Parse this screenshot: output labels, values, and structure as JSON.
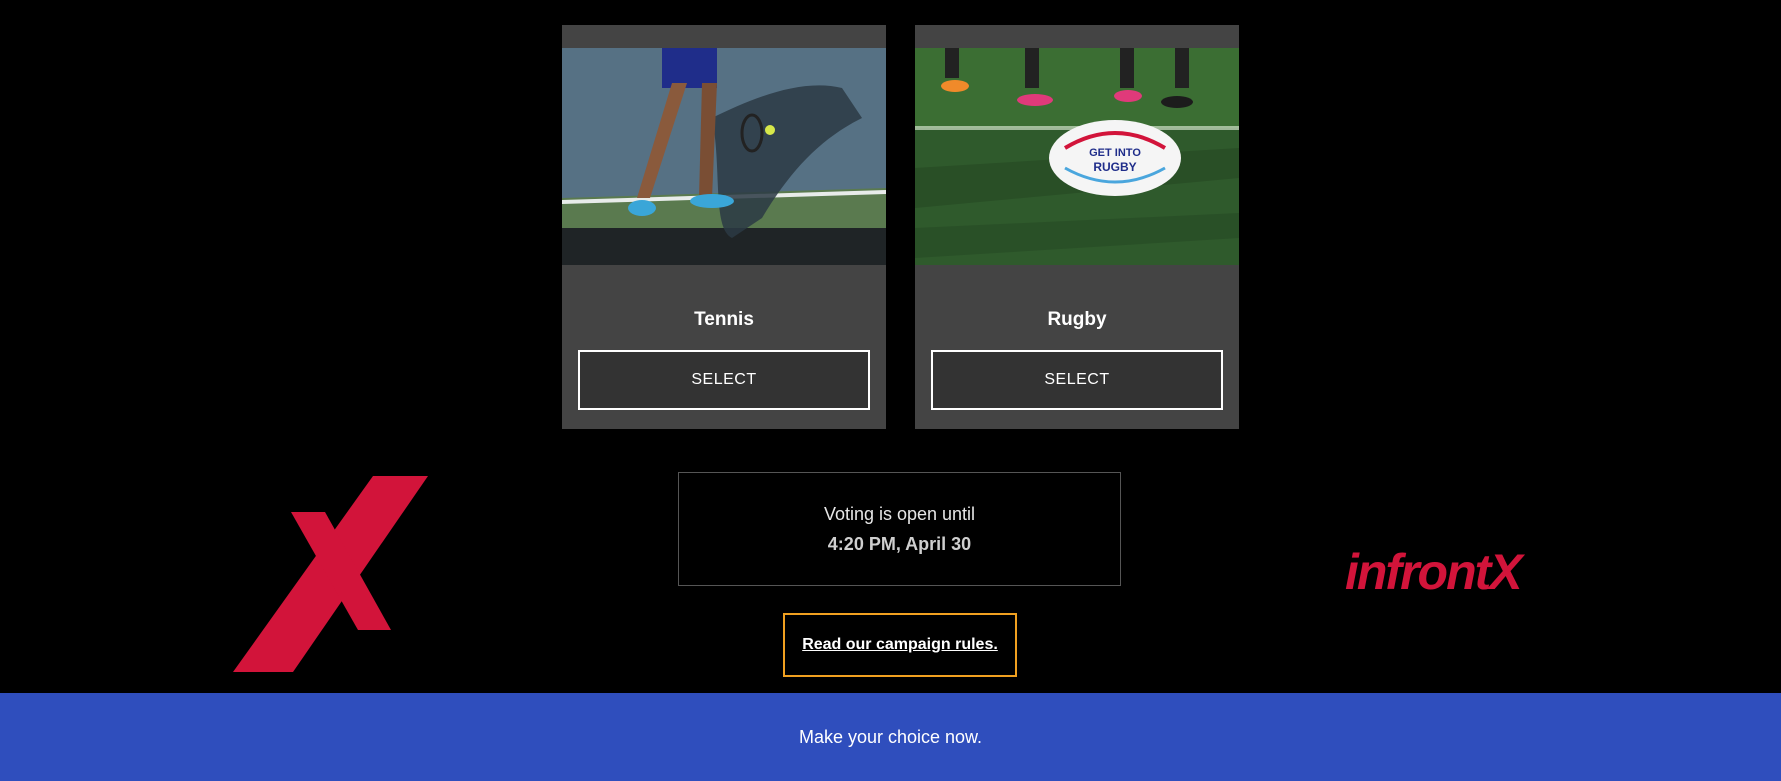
{
  "cards": [
    {
      "title": "Tennis",
      "button_label": "SELECT"
    },
    {
      "title": "Rugby",
      "button_label": "SELECT"
    }
  ],
  "voting": {
    "label": "Voting is open until",
    "deadline": "4:20 PM, April 30"
  },
  "rules_link": "Read our campaign rules.",
  "footer": {
    "text": "Make your choice now."
  },
  "logos": {
    "left": {
      "icon": "x-logo-icon"
    },
    "right": {
      "text": "infrontX"
    }
  },
  "colors": {
    "brand_red": "#d2143a",
    "footer_blue": "#2f4ebd",
    "focus_orange": "#f0a020",
    "card_bg": "#444444"
  }
}
